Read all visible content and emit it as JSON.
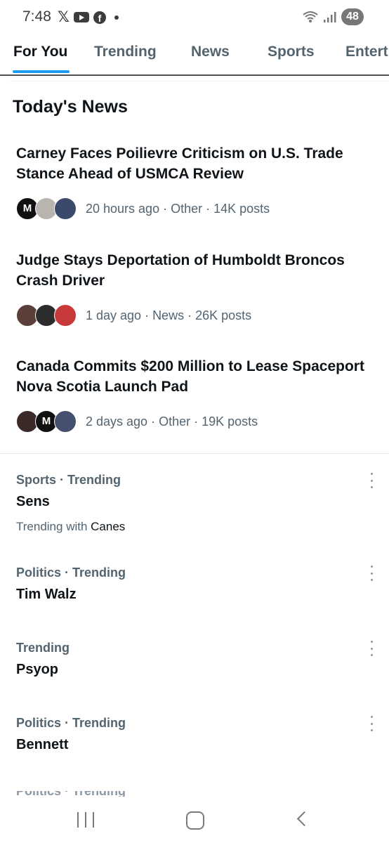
{
  "status_bar": {
    "time": "7:48",
    "battery": "48",
    "x_logo": "𝕏"
  },
  "tabs": [
    {
      "label": "For You",
      "active": true
    },
    {
      "label": "Trending",
      "active": false
    },
    {
      "label": "News",
      "active": false
    },
    {
      "label": "Sports",
      "active": false
    },
    {
      "label": "Entert",
      "active": false
    }
  ],
  "news_section": {
    "title": "Today's News",
    "items": [
      {
        "headline": "Carney Faces Poilievre Criticism on U.S. Trade Stance Ahead of USMCA Review",
        "meta": "20 hours ago · Other · 14K posts",
        "avatar_logo": "M"
      },
      {
        "headline": "Judge Stays Deportation of Humboldt Broncos Crash Driver",
        "meta": "1 day ago · News · 26K posts"
      },
      {
        "headline": "Canada Commits $200 Million to Lease Spaceport Nova Scotia Launch Pad",
        "meta": "2 days ago · Other · 19K posts",
        "avatar_logo": "M"
      }
    ]
  },
  "trends": [
    {
      "context": "Sports · Trending",
      "name": "Sens",
      "with_prefix": "Trending with",
      "with_name": "Canes"
    },
    {
      "context": "Politics · Trending",
      "name": "Tim Walz"
    },
    {
      "context": "Trending",
      "name": "Psyop"
    },
    {
      "context": "Politics · Trending",
      "name": "Bennett"
    }
  ],
  "partial_trend": {
    "context": "Politics · Trending"
  },
  "colors": {
    "accent": "#1d9bf0",
    "text_primary": "#0f1419",
    "text_secondary": "#536471"
  }
}
